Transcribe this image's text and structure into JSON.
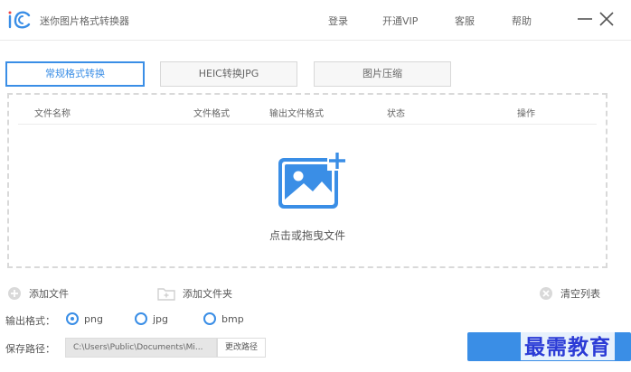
{
  "app": {
    "title": "迷你图片格式转换器",
    "menu": [
      "登录",
      "开通VIP",
      "客服",
      "帮助"
    ],
    "accent": "#3a8ee6"
  },
  "tabs": [
    {
      "label": "常规格式转换",
      "active": true
    },
    {
      "label": "HEIC转换JPG",
      "active": false
    },
    {
      "label": "图片压缩",
      "active": false
    }
  ],
  "table": {
    "columns": [
      "文件名称",
      "文件格式",
      "输出文件格式",
      "状态",
      "操作"
    ]
  },
  "dropzone": {
    "hint": "点击或拖曳文件",
    "icon": "image-plus-icon"
  },
  "actions": {
    "add_file": "添加文件",
    "add_folder": "添加文件夹",
    "clear_list": "清空列表"
  },
  "output_format": {
    "label": "输出格式：",
    "options": [
      "png",
      "jpg",
      "bmp"
    ],
    "selected": "png"
  },
  "save_path": {
    "label": "保存路径：",
    "value": "C:\\Users\\Public\\Documents\\Mi...",
    "change_label": "更改路径"
  },
  "watermark": "最需教育"
}
